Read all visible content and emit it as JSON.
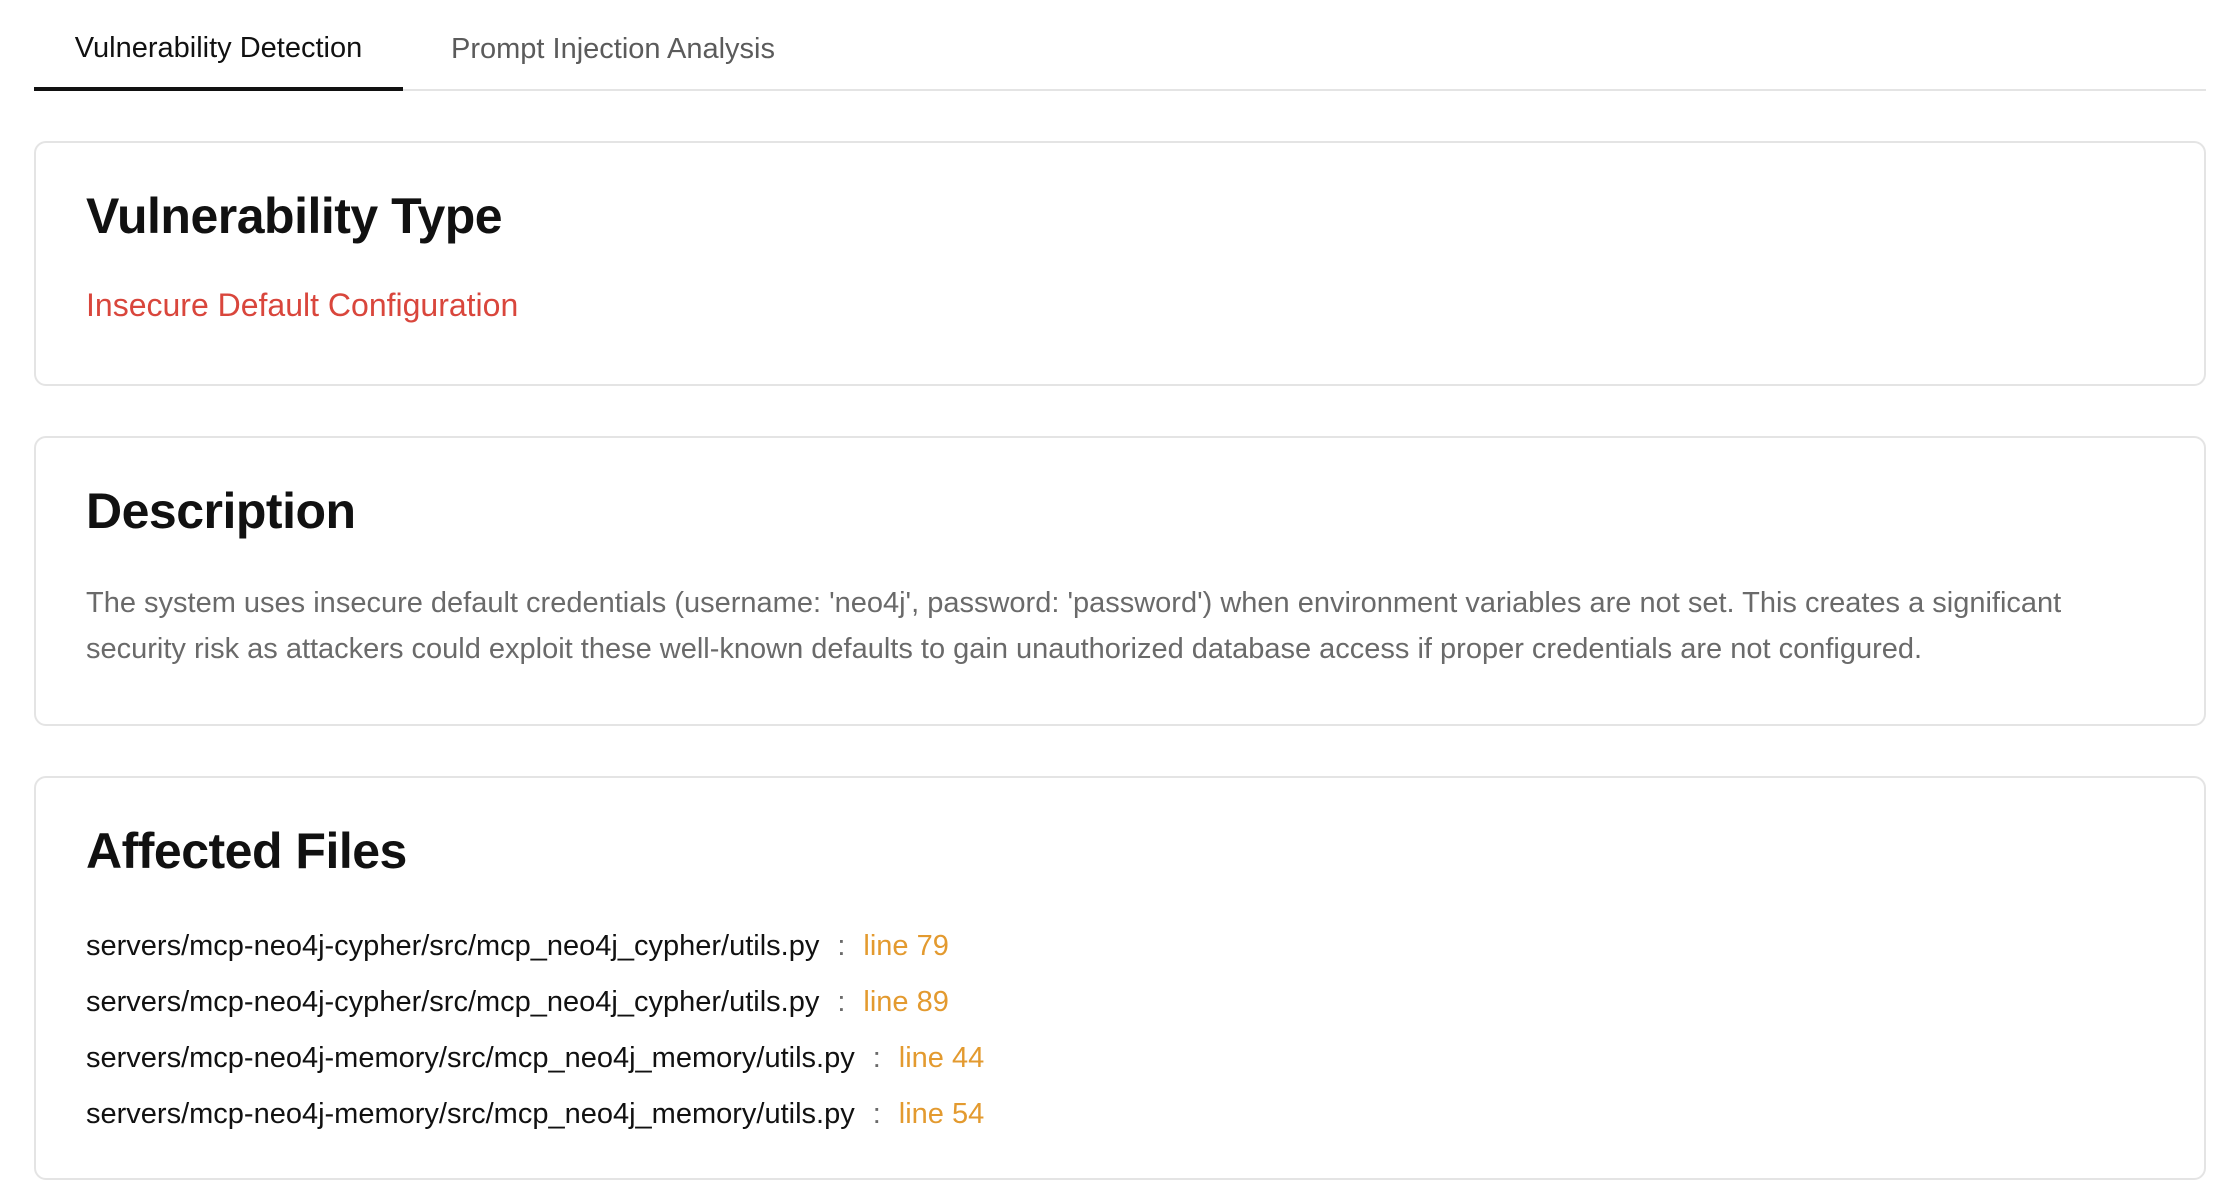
{
  "tabs": [
    {
      "label": "Vulnerability Detection",
      "active": true
    },
    {
      "label": "Prompt Injection Analysis",
      "active": false
    }
  ],
  "vulnerability_type": {
    "title": "Vulnerability Type",
    "value": "Insecure Default Configuration"
  },
  "description": {
    "title": "Description",
    "text": "The system uses insecure default credentials (username: 'neo4j', password: 'password') when environment variables are not set. This creates a significant security risk as attackers could exploit these well-known defaults to gain unauthorized database access if proper credentials are not configured."
  },
  "affected_files": {
    "title": "Affected Files",
    "separator": ":",
    "items": [
      {
        "path": "servers/mcp-neo4j-cypher/src/mcp_neo4j_cypher/utils.py",
        "line": "line 79"
      },
      {
        "path": "servers/mcp-neo4j-cypher/src/mcp_neo4j_cypher/utils.py",
        "line": "line 89"
      },
      {
        "path": "servers/mcp-neo4j-memory/src/mcp_neo4j_memory/utils.py",
        "line": "line 44"
      },
      {
        "path": "servers/mcp-neo4j-memory/src/mcp_neo4j_memory/utils.py",
        "line": "line 54"
      }
    ]
  },
  "colors": {
    "type_value": "#d9463c",
    "line_ref": "#e39a2f",
    "muted_text": "#6a6a6a",
    "border": "#e4e4e4",
    "active_tab_underline": "#111111"
  }
}
